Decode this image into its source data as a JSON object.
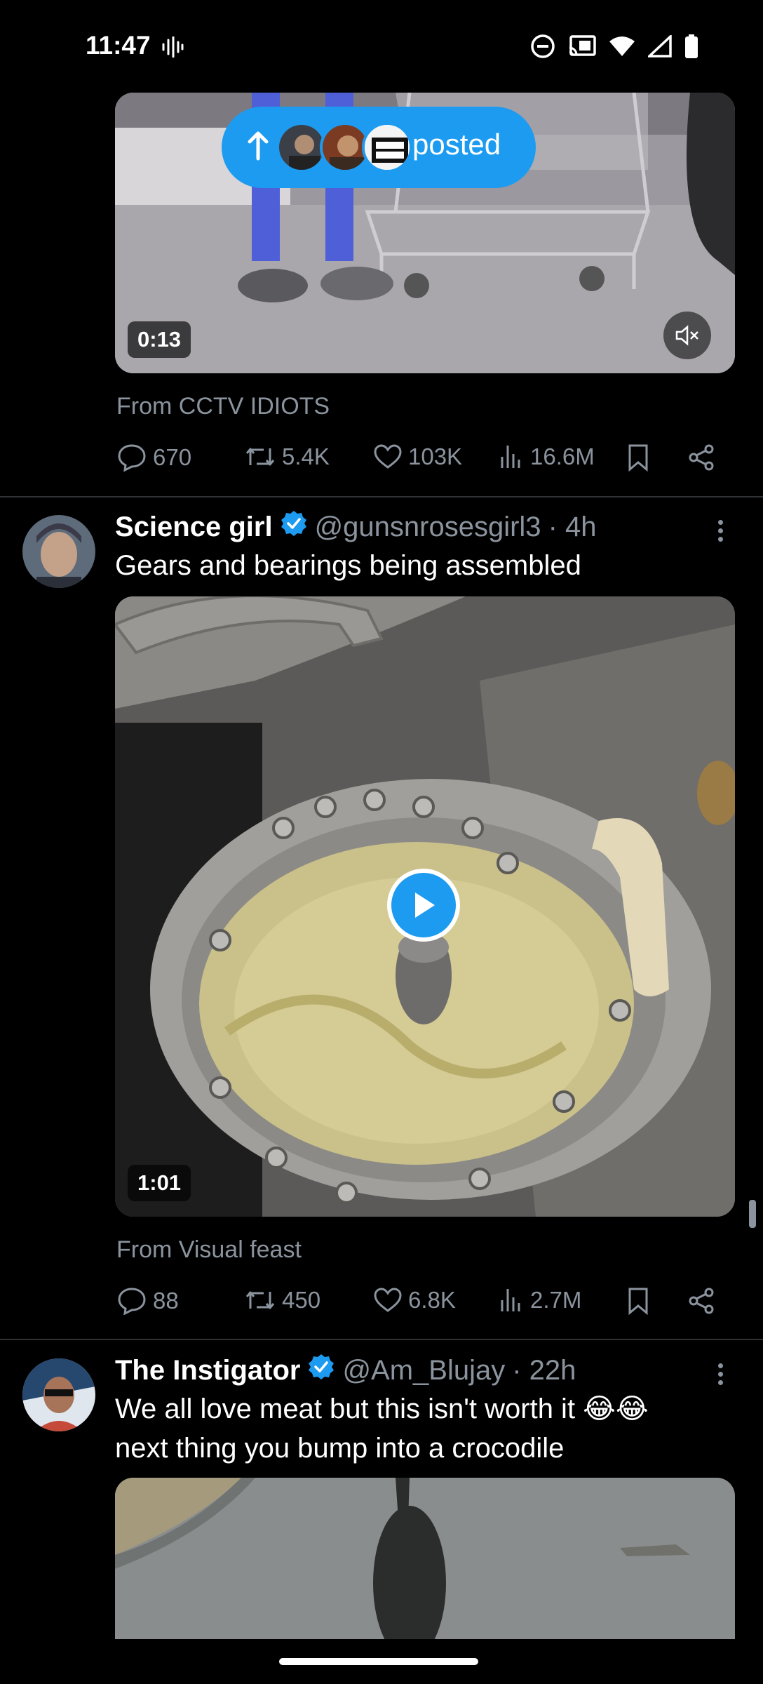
{
  "status_bar": {
    "time": "11:47",
    "icons": [
      "soundwave-icon",
      "do-not-disturb-icon",
      "cast-icon",
      "wifi-icon",
      "signal-icon",
      "battery-icon"
    ]
  },
  "posted_pill": {
    "label": "posted",
    "icon": "arrow-up-icon"
  },
  "post1": {
    "duration": "0:13",
    "source": "From CCTV IDIOTS",
    "replies": "670",
    "reposts": "5.4K",
    "likes": "103K",
    "views": "16.6M"
  },
  "post2": {
    "name": "Science girl",
    "handle": "@gunsnrosesgirl3",
    "time": "· 4h",
    "text": "Gears and bearings being assembled",
    "duration": "1:01",
    "source": "From Visual feast",
    "replies": "88",
    "reposts": "450",
    "likes": "6.8K",
    "views": "2.7M"
  },
  "post3": {
    "name": "The Instigator",
    "handle": "@Am_Blujay",
    "time": "· 22h",
    "text_line1": "We all love meat but this isn't worth it 😂😂",
    "text_line2": "next thing you bump into a crocodile"
  },
  "colors": {
    "accent": "#1d9bf0",
    "muted": "#8b949e",
    "background": "#000000"
  }
}
